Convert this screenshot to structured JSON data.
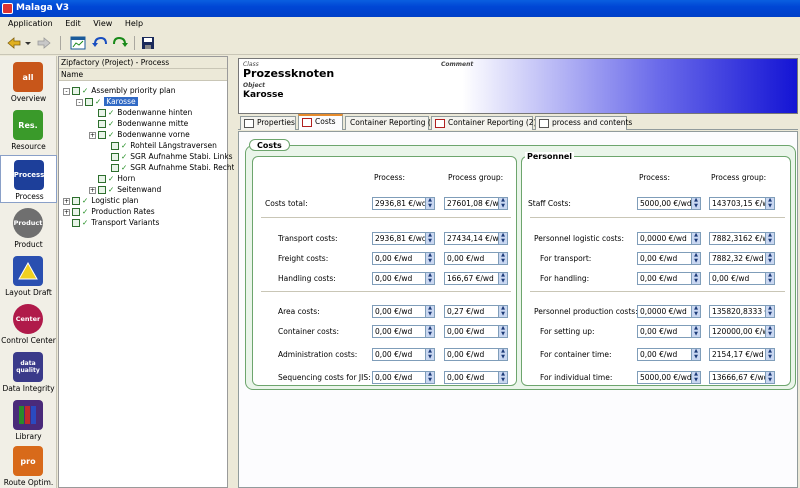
{
  "app": {
    "title": "Malaga V3"
  },
  "menu": [
    "Application",
    "Edit",
    "View",
    "Help"
  ],
  "sidebar": {
    "items": [
      {
        "label": "Overview",
        "icon": "overview-icon",
        "color": "#c8561a",
        "glyph": "all"
      },
      {
        "label": "Resource",
        "icon": "resource-icon",
        "color": "#3a9a2a",
        "glyph": "Res."
      },
      {
        "label": "Process",
        "icon": "process-icon",
        "color": "#1d3f9a",
        "glyph": "Process",
        "selected": true
      },
      {
        "label": "Product",
        "icon": "product-icon",
        "color": "#6f6f6f",
        "glyph": "Product"
      },
      {
        "label": "Layout Draft",
        "icon": "layout-draft-icon",
        "color": "#2a4fb0",
        "glyph": ""
      },
      {
        "label": "Control Center",
        "icon": "control-center-icon",
        "color": "#b01a4a",
        "glyph": "Center"
      },
      {
        "label": "Data Integrity",
        "icon": "data-integrity-icon",
        "color": "#3a3a8a",
        "glyph": "data quality"
      },
      {
        "label": "Library",
        "icon": "library-icon",
        "color": "#4a2a7a",
        "glyph": ""
      },
      {
        "label": "Route Optim.",
        "icon": "route-optim-icon",
        "color": "#d86a1a",
        "glyph": "pro"
      }
    ]
  },
  "tree": {
    "title": "Zipfactory (Project) - Process",
    "column": "Name",
    "rows": [
      {
        "label": "Assembly priority plan",
        "indent": 0,
        "toggle": "-",
        "selected": false
      },
      {
        "label": "Karosse",
        "indent": 1,
        "toggle": "-",
        "selected": true
      },
      {
        "label": "Bodenwanne hinten",
        "indent": 2,
        "toggle": "",
        "selected": false
      },
      {
        "label": "Bodenwanne mitte",
        "indent": 2,
        "toggle": "",
        "selected": false
      },
      {
        "label": "Bodenwanne vorne",
        "indent": 2,
        "toggle": "+",
        "selected": false
      },
      {
        "label": "Rohteil Längstraversen",
        "indent": 3,
        "toggle": "",
        "selected": false
      },
      {
        "label": "SGR Aufnahme Stabi. Links",
        "indent": 3,
        "toggle": "",
        "selected": false
      },
      {
        "label": "SGR Aufnahme Stabi. Rechts",
        "indent": 3,
        "toggle": "",
        "selected": false
      },
      {
        "label": "Horn",
        "indent": 2,
        "toggle": "",
        "selected": false
      },
      {
        "label": "Seitenwand",
        "indent": 2,
        "toggle": "+",
        "selected": false
      },
      {
        "label": "Logistic plan",
        "indent": 0,
        "toggle": "+",
        "selected": false
      },
      {
        "label": "Production Rates",
        "indent": 0,
        "toggle": "+",
        "selected": false
      },
      {
        "label": "Transport Variants",
        "indent": 0,
        "toggle": "",
        "selected": false
      }
    ]
  },
  "header": {
    "class_label": "Class",
    "class_value": "Prozessknoten",
    "comment_label": "Comment",
    "object_label": "Object",
    "object_value": "Karosse"
  },
  "tabs": [
    "Properties",
    "Costs",
    "Container Reporting (1)",
    "Container Reporting (2)",
    "process and contents"
  ],
  "costs": {
    "title": "Costs",
    "col_process": "Process:",
    "col_group": "Process group:",
    "rows": [
      {
        "label": "Costs total:",
        "process": "2936,81 €/wd",
        "group": "27601,08 €/wd"
      },
      {
        "label": "Transport costs:",
        "process": "2936,81 €/wd",
        "group": "27434,14 €/wd"
      },
      {
        "label": "Freight costs:",
        "process": "0,00 €/wd",
        "group": "0,00 €/wd"
      },
      {
        "label": "Handling costs:",
        "process": "0,00 €/wd",
        "group": "166,67 €/wd"
      },
      {
        "label": "Area costs:",
        "process": "0,00 €/wd",
        "group": "0,27 €/wd"
      },
      {
        "label": "Container costs:",
        "process": "0,00 €/wd",
        "group": "0,00 €/wd"
      },
      {
        "label": "Administration costs:",
        "process": "0,00 €/wd",
        "group": "0,00 €/wd"
      },
      {
        "label": "Sequencing costs for JIS:",
        "process": "0,00 €/wd",
        "group": "0,00 €/wd"
      }
    ]
  },
  "personnel": {
    "title": "Personnel",
    "col_process": "Process:",
    "col_group": "Process group:",
    "rows": [
      {
        "label": "Staff Costs:",
        "process": "5000,00 €/wd",
        "group": "143703,15 €/wd"
      },
      {
        "label": "Personnel logistic costs:",
        "process": "0,0000 €/wd",
        "group": "7882,3162 €/wd"
      },
      {
        "label": "For transport:",
        "process": "0,00 €/wd",
        "group": "7882,32 €/wd"
      },
      {
        "label": "For handling:",
        "process": "0,00 €/wd",
        "group": "0,00 €/wd"
      },
      {
        "label": "Personnel production costs:",
        "process": "0,0000 €/wd",
        "group": "135820,8333 €/wd"
      },
      {
        "label": "For setting up:",
        "process": "0,00 €/wd",
        "group": "120000,00 €/wd"
      },
      {
        "label": "For container time:",
        "process": "0,00 €/wd",
        "group": "2154,17 €/wd"
      },
      {
        "label": "For individual time:",
        "process": "5000,00 €/wd",
        "group": "13666,67 €/wd"
      }
    ]
  }
}
